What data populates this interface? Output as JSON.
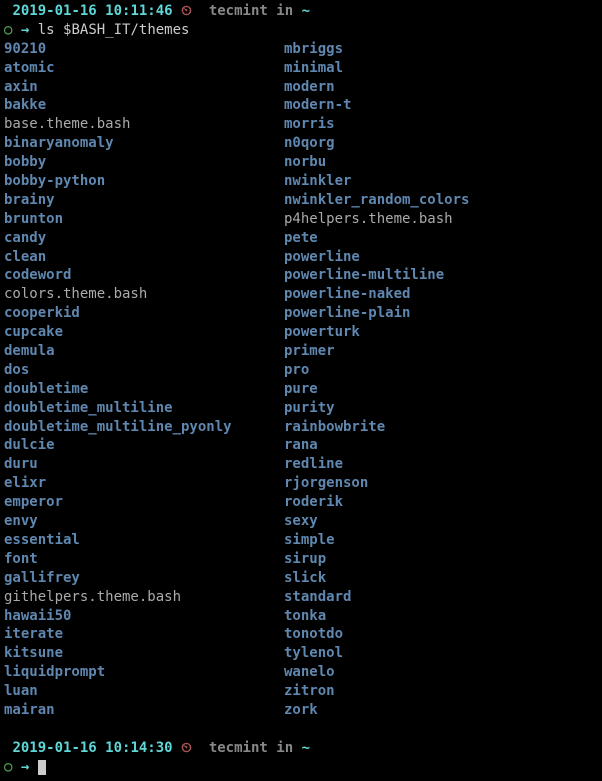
{
  "prompt1": {
    "timestamp": "2019-01-16 10:11:46",
    "clock": "⏲",
    "username": "tecmint",
    "in": "in",
    "path": "~",
    "circle": "○",
    "arrow": "→",
    "command": "ls $BASH_IT/themes"
  },
  "prompt2": {
    "timestamp": "2019-01-16 10:14:30",
    "clock": "⏲",
    "username": "tecmint",
    "in": "in",
    "path": "~",
    "circle": "○",
    "arrow": "→"
  },
  "col1": [
    {
      "name": "90210",
      "type": "dir"
    },
    {
      "name": "atomic",
      "type": "dir"
    },
    {
      "name": "axin",
      "type": "dir"
    },
    {
      "name": "bakke",
      "type": "dir"
    },
    {
      "name": "base.theme.bash",
      "type": "file"
    },
    {
      "name": "binaryanomaly",
      "type": "dir"
    },
    {
      "name": "bobby",
      "type": "dir"
    },
    {
      "name": "bobby-python",
      "type": "dir"
    },
    {
      "name": "brainy",
      "type": "dir"
    },
    {
      "name": "brunton",
      "type": "dir"
    },
    {
      "name": "candy",
      "type": "dir"
    },
    {
      "name": "clean",
      "type": "dir"
    },
    {
      "name": "codeword",
      "type": "dir"
    },
    {
      "name": "colors.theme.bash",
      "type": "file"
    },
    {
      "name": "cooperkid",
      "type": "dir"
    },
    {
      "name": "cupcake",
      "type": "dir"
    },
    {
      "name": "demula",
      "type": "dir"
    },
    {
      "name": "dos",
      "type": "dir"
    },
    {
      "name": "doubletime",
      "type": "dir"
    },
    {
      "name": "doubletime_multiline",
      "type": "dir"
    },
    {
      "name": "doubletime_multiline_pyonly",
      "type": "dir"
    },
    {
      "name": "dulcie",
      "type": "dir"
    },
    {
      "name": "duru",
      "type": "dir"
    },
    {
      "name": "elixr",
      "type": "dir"
    },
    {
      "name": "emperor",
      "type": "dir"
    },
    {
      "name": "envy",
      "type": "dir"
    },
    {
      "name": "essential",
      "type": "dir"
    },
    {
      "name": "font",
      "type": "dir"
    },
    {
      "name": "gallifrey",
      "type": "dir"
    },
    {
      "name": "githelpers.theme.bash",
      "type": "file"
    },
    {
      "name": "hawaii50",
      "type": "dir"
    },
    {
      "name": "iterate",
      "type": "dir"
    },
    {
      "name": "kitsune",
      "type": "dir"
    },
    {
      "name": "liquidprompt",
      "type": "dir"
    },
    {
      "name": "luan",
      "type": "dir"
    },
    {
      "name": "mairan",
      "type": "dir"
    }
  ],
  "col2": [
    {
      "name": "mbriggs",
      "type": "dir"
    },
    {
      "name": "minimal",
      "type": "dir"
    },
    {
      "name": "modern",
      "type": "dir"
    },
    {
      "name": "modern-t",
      "type": "dir"
    },
    {
      "name": "morris",
      "type": "dir"
    },
    {
      "name": "n0qorg",
      "type": "dir"
    },
    {
      "name": "norbu",
      "type": "dir"
    },
    {
      "name": "nwinkler",
      "type": "dir"
    },
    {
      "name": "nwinkler_random_colors",
      "type": "dir"
    },
    {
      "name": "p4helpers.theme.bash",
      "type": "file"
    },
    {
      "name": "pete",
      "type": "dir"
    },
    {
      "name": "powerline",
      "type": "dir"
    },
    {
      "name": "powerline-multiline",
      "type": "dir"
    },
    {
      "name": "powerline-naked",
      "type": "dir"
    },
    {
      "name": "powerline-plain",
      "type": "dir"
    },
    {
      "name": "powerturk",
      "type": "dir"
    },
    {
      "name": "primer",
      "type": "dir"
    },
    {
      "name": "pro",
      "type": "dir"
    },
    {
      "name": "pure",
      "type": "dir"
    },
    {
      "name": "purity",
      "type": "dir"
    },
    {
      "name": "rainbowbrite",
      "type": "dir"
    },
    {
      "name": "rana",
      "type": "dir"
    },
    {
      "name": "redline",
      "type": "dir"
    },
    {
      "name": "rjorgenson",
      "type": "dir"
    },
    {
      "name": "roderik",
      "type": "dir"
    },
    {
      "name": "sexy",
      "type": "dir"
    },
    {
      "name": "simple",
      "type": "dir"
    },
    {
      "name": "sirup",
      "type": "dir"
    },
    {
      "name": "slick",
      "type": "dir"
    },
    {
      "name": "standard",
      "type": "dir"
    },
    {
      "name": "tonka",
      "type": "dir"
    },
    {
      "name": "tonotdo",
      "type": "dir"
    },
    {
      "name": "tylenol",
      "type": "dir"
    },
    {
      "name": "wanelo",
      "type": "dir"
    },
    {
      "name": "zitron",
      "type": "dir"
    },
    {
      "name": "zork",
      "type": "dir"
    }
  ]
}
